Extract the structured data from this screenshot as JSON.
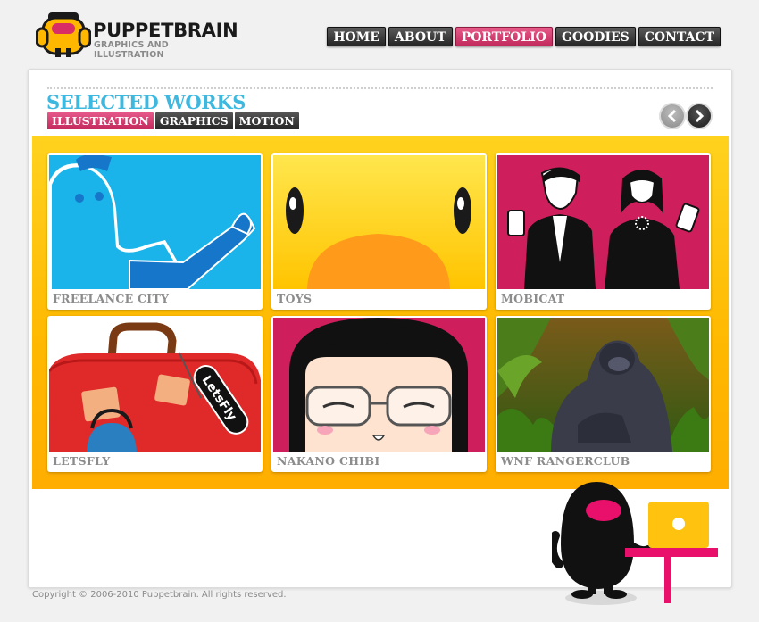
{
  "brand": {
    "name": "PUPPETBRAIN",
    "tagline": "GRAPHICS AND ILLUSTRATION",
    "accent": "#c7305f",
    "title_blue": "#3fb8e0",
    "panel_yellow": "#ffc20e"
  },
  "nav": {
    "items": [
      {
        "label": "HOME",
        "active": false
      },
      {
        "label": "ABOUT",
        "active": false
      },
      {
        "label": "PORTFOLIO",
        "active": true
      },
      {
        "label": "GOODIES",
        "active": false
      },
      {
        "label": "CONTACT",
        "active": false
      }
    ]
  },
  "portfolio": {
    "title": "SELECTED WORKS",
    "tabs": [
      {
        "label": "ILLUSTRATION",
        "active": true
      },
      {
        "label": "GRAPHICS",
        "active": false
      },
      {
        "label": "MOTION",
        "active": false
      }
    ],
    "prev_icon": "chevron-left-icon",
    "next_icon": "chevron-right-icon",
    "items": [
      {
        "label": "FREELANCE CITY",
        "thumb": "freelance-city-illustration"
      },
      {
        "label": "TOYS",
        "thumb": "toys-illustration"
      },
      {
        "label": "MOBICAT",
        "thumb": "mobicat-illustration"
      },
      {
        "label": "LETSFLY",
        "thumb": "letsfly-illustration"
      },
      {
        "label": "NAKANO CHIBI",
        "thumb": "nakano-chibi-illustration"
      },
      {
        "label": "WNF RANGERCLUB",
        "thumb": "wnf-rangerclub-illustration"
      }
    ],
    "letsfly_tag": "LetsFly"
  },
  "footer": {
    "copyright": "Copyright © 2006-2010 Puppetbrain. All rights reserved."
  }
}
